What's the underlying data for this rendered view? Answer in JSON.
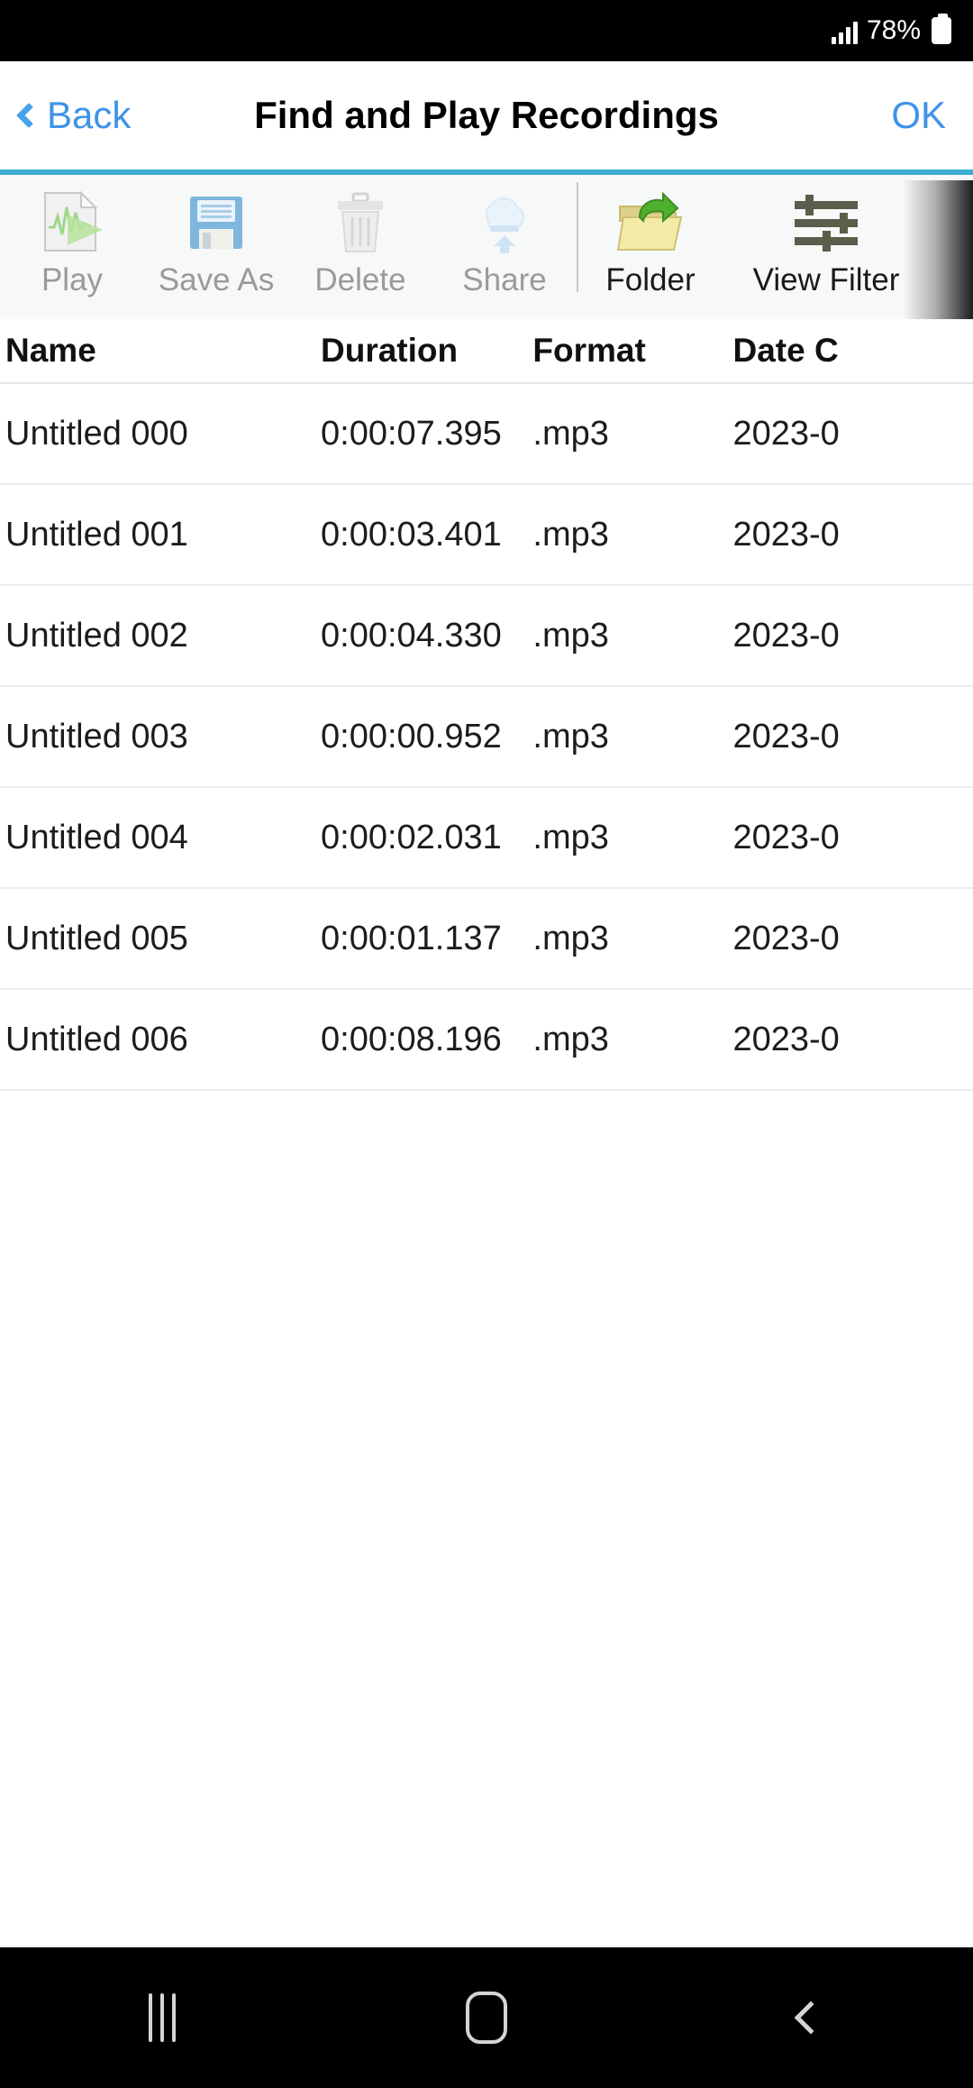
{
  "status_bar": {
    "battery_percent": "78%",
    "signal_icon": "signal-bars-icon",
    "battery_icon": "battery-icon"
  },
  "header": {
    "back_label": "Back",
    "title": "Find and Play Recordings",
    "ok_label": "OK",
    "accent_color": "#3f93e8"
  },
  "toolbar": {
    "accent_bar_color": "#3fadd3",
    "items": [
      {
        "label": "Play",
        "icon": "play-document-icon",
        "enabled": false
      },
      {
        "label": "Save As",
        "icon": "floppy-disk-icon",
        "enabled": false
      },
      {
        "label": "Delete",
        "icon": "trash-can-icon",
        "enabled": false
      },
      {
        "label": "Share",
        "icon": "cloud-upload-icon",
        "enabled": false
      },
      {
        "label": "Folder",
        "icon": "open-folder-icon",
        "enabled": true
      },
      {
        "label": "View Filter",
        "icon": "sliders-icon",
        "enabled": true
      }
    ]
  },
  "table": {
    "columns": [
      "Name",
      "Duration",
      "Format",
      "Date C"
    ],
    "rows": [
      {
        "name": "Untitled 000",
        "duration": "0:00:07.395",
        "format": ".mp3",
        "date": "2023-0"
      },
      {
        "name": "Untitled 001",
        "duration": "0:00:03.401",
        "format": ".mp3",
        "date": "2023-0"
      },
      {
        "name": "Untitled 002",
        "duration": "0:00:04.330",
        "format": ".mp3",
        "date": "2023-0"
      },
      {
        "name": "Untitled 003",
        "duration": "0:00:00.952",
        "format": ".mp3",
        "date": "2023-0"
      },
      {
        "name": "Untitled 004",
        "duration": "0:00:02.031",
        "format": ".mp3",
        "date": "2023-0"
      },
      {
        "name": "Untitled 005",
        "duration": "0:00:01.137",
        "format": ".mp3",
        "date": "2023-0"
      },
      {
        "name": "Untitled 006",
        "duration": "0:00:08.196",
        "format": ".mp3",
        "date": "2023-0"
      }
    ]
  },
  "system_nav": {
    "recents_icon": "recents-icon",
    "home_icon": "home-icon",
    "back_icon": "back-chevron-icon"
  }
}
